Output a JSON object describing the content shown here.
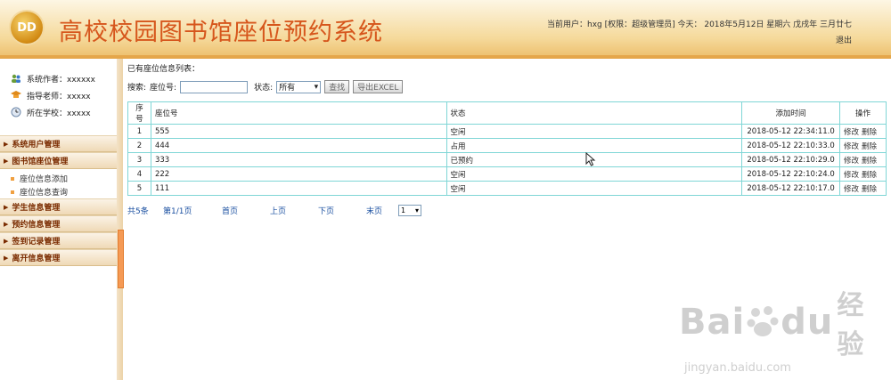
{
  "header": {
    "logo_text": "DD",
    "title": "高校校园图书馆座位预约系统",
    "user_info": "当前用户：hxg [权限：超级管理员]  今天： 2018年5月12日   星期六   戊戌年  三月廿七",
    "logout": "退出"
  },
  "sidebar": {
    "info": [
      {
        "label": "系统作者：xxxxxx"
      },
      {
        "label": "指导老师：xxxxx"
      },
      {
        "label": "所在学校：xxxxx"
      }
    ],
    "menus": {
      "m1": "系统用户管理",
      "m2": "图书馆座位管理",
      "m2_sub1": "座位信息添加",
      "m2_sub2": "座位信息查询",
      "m3": "学生信息管理",
      "m4": "预约信息管理",
      "m5": "签到记录管理",
      "m6": "离开信息管理"
    }
  },
  "main": {
    "caption": "已有座位信息列表：",
    "search_label": "搜索:",
    "seat_label": "座位号:",
    "seat_value": "",
    "status_label": "状态:",
    "status_selected": "所有",
    "search_button": "查找",
    "export_button": "导出EXCEL"
  },
  "table": {
    "headers": [
      "序号",
      "座位号",
      "状态",
      "添加时间",
      "操作"
    ],
    "rows": [
      {
        "idx": "1",
        "seat": "555",
        "status": "空闲",
        "time": "2018-05-12 22:34:11.0"
      },
      {
        "idx": "2",
        "seat": "444",
        "status": "占用",
        "time": "2018-05-12 22:10:33.0"
      },
      {
        "idx": "3",
        "seat": "333",
        "status": "已预约",
        "time": "2018-05-12 22:10:29.0"
      },
      {
        "idx": "4",
        "seat": "222",
        "status": "空闲",
        "time": "2018-05-12 22:10:24.0"
      },
      {
        "idx": "5",
        "seat": "111",
        "status": "空闲",
        "time": "2018-05-12 22:10:17.0"
      }
    ],
    "edit": "修改",
    "delete": "删除"
  },
  "pager": {
    "total": "共5条",
    "page_info": "第1/1页",
    "first": "首页",
    "prev": "上页",
    "next": "下页",
    "last": "末页",
    "page_select": "1"
  },
  "watermark": {
    "brand": "Bai",
    "brand2": "du",
    "brand_cn": "经验",
    "url": "jingyan.baidu.com"
  }
}
